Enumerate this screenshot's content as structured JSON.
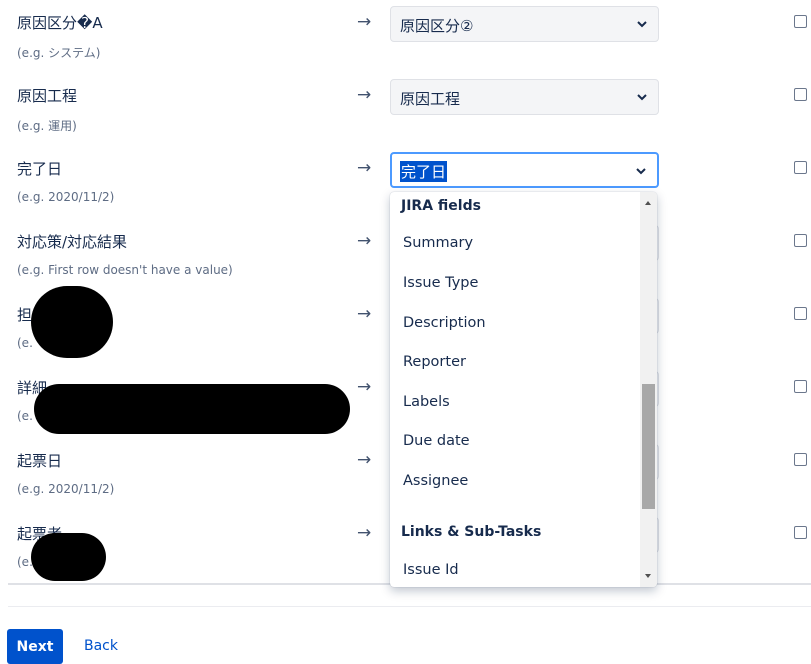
{
  "arrow_glyph": "→",
  "rows": [
    {
      "name": "原因区分�A",
      "example": "(e.g. システム)",
      "select": "原因区分②"
    },
    {
      "name": "原因工程",
      "example": "(e.g. 運用)",
      "select": "原因工程"
    },
    {
      "name": "完了日",
      "example": "(e.g. 2020/11/2)",
      "select": "完了日"
    },
    {
      "name": "対応策/対応結果",
      "example": "(e.g. First row doesn't have a value)",
      "select": ""
    },
    {
      "name": "担当者",
      "example": "(e.",
      "select": ""
    },
    {
      "name": "詳細",
      "example": "(e.",
      "select": ""
    },
    {
      "name": "起票日",
      "example": "(e.g. 2020/11/2)",
      "select": ""
    },
    {
      "name": "起票者",
      "example": "(e.",
      "select": ""
    }
  ],
  "dropdown": {
    "groups": [
      {
        "heading": "JIRA fields",
        "options": [
          "Summary",
          "Issue Type",
          "Description",
          "Reporter",
          "Labels",
          "Due date",
          "Assignee"
        ]
      },
      {
        "heading": "Links & Sub-Tasks",
        "options": [
          "Issue Id"
        ]
      }
    ]
  },
  "footer": {
    "next_label": "Next",
    "back_label": "Back"
  },
  "colors": {
    "primary": "#0052cc",
    "focus_border": "#4c9aff",
    "text": "#172b4d",
    "subtle_text": "#5e6c84"
  },
  "icons": {
    "select_indicator": "chevron-down-icon",
    "row_arrow": "right-arrow-icon"
  }
}
